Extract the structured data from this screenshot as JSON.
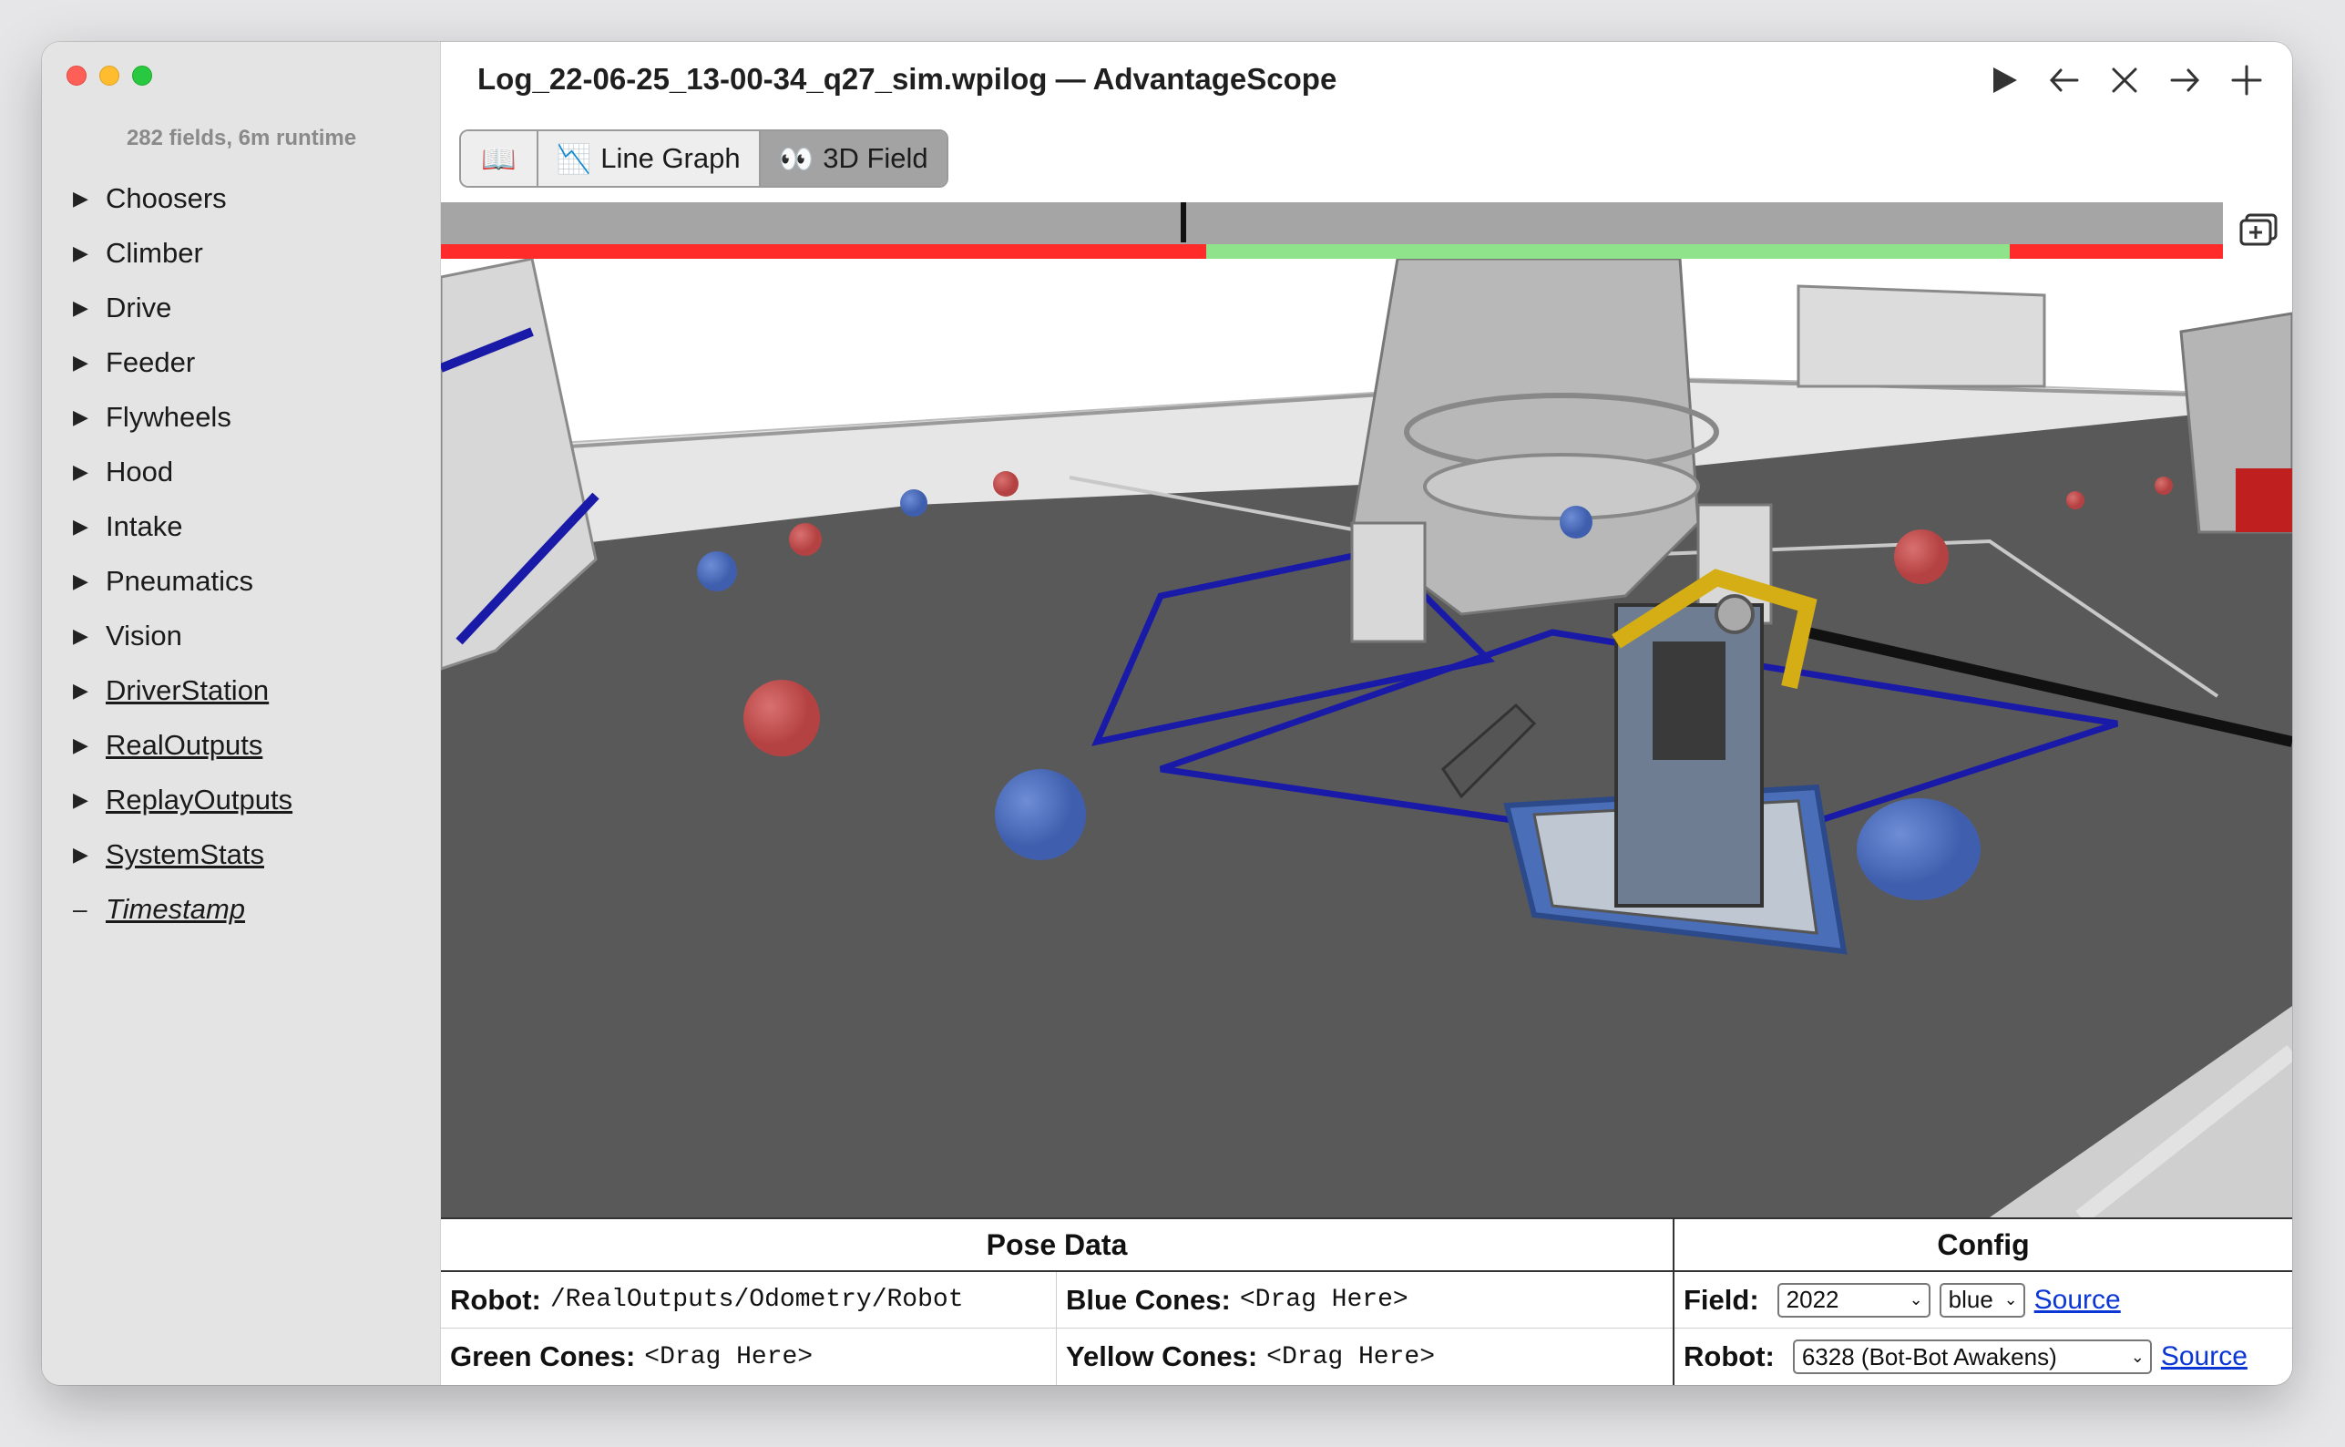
{
  "window": {
    "title": "Log_22-06-25_13-00-34_q27_sim.wpilog — AdvantageScope"
  },
  "sidebar": {
    "summary": "282 fields, 6m runtime",
    "items": [
      {
        "label": "Choosers"
      },
      {
        "label": "Climber"
      },
      {
        "label": "Drive"
      },
      {
        "label": "Feeder"
      },
      {
        "label": "Flywheels"
      },
      {
        "label": "Hood"
      },
      {
        "label": "Intake"
      },
      {
        "label": "Pneumatics"
      },
      {
        "label": "Vision"
      },
      {
        "label": "DriverStation"
      },
      {
        "label": "RealOutputs"
      },
      {
        "label": "ReplayOutputs"
      },
      {
        "label": "SystemStats"
      },
      {
        "label": "Timestamp"
      }
    ]
  },
  "tabs": [
    {
      "icon": "📖",
      "label": ""
    },
    {
      "icon": "📉",
      "label": "Line Graph"
    },
    {
      "icon": "👀",
      "label": "3D Field"
    }
  ],
  "timeline": {
    "status_colors": {
      "disabled": "#ff2a2a",
      "enabled": "#8fe38a"
    },
    "cursor_position": 0.415
  },
  "pose_data": {
    "header": "Pose Data",
    "robot_label": "Robot:",
    "robot_value": "/RealOutputs/Odometry/Robot",
    "blue_label": "Blue Cones:",
    "blue_value": "<Drag Here>",
    "green_label": "Green Cones:",
    "green_value": "<Drag Here>",
    "yellow_label": "Yellow Cones:",
    "yellow_value": "<Drag Here>"
  },
  "config": {
    "header": "Config",
    "field_label": "Field:",
    "field_value": "2022",
    "alliance_value": "blue",
    "field_source": "Source",
    "robot_label": "Robot:",
    "robot_value": "6328 (Bot-Bot Awakens)",
    "robot_source": "Source"
  }
}
